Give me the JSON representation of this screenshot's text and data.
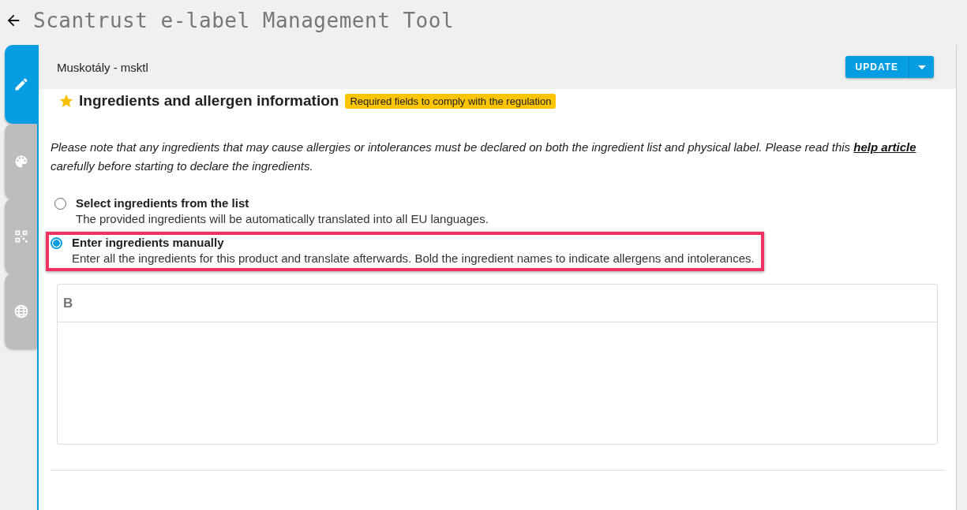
{
  "app_bar": {
    "title": "Scantrust e-label Management Tool"
  },
  "side_tabs": [
    {
      "kind": "pencil",
      "selected": true
    },
    {
      "kind": "palette",
      "selected": false
    },
    {
      "kind": "qr",
      "selected": false
    },
    {
      "kind": "globe",
      "selected": false
    }
  ],
  "panel": {
    "product": "Muskotály - msktl",
    "update_button": "UPDATE"
  },
  "section": {
    "title": "Ingredients and allergen information",
    "badge": "Required fields to comply with the regulation",
    "note_before": "Please note that any ingredients that may cause allergies or intolerances must be declared on both the ingredient list and physical label. Please read this",
    "note_link": "help article",
    "note_after": "carefully before starting to declare the ingredients."
  },
  "options": [
    {
      "label": "Select ingredients from the list",
      "description": "The provided ingredients will be automatically translated into all EU languages.",
      "selected": false,
      "highlighted": false
    },
    {
      "label": "Enter ingredients manually",
      "description": "Enter all the ingredients for this product and translate afterwards. Bold the ingredient names to indicate allergens and intolerances.",
      "selected": true,
      "highlighted": true
    }
  ],
  "editor": {
    "toolbar": [
      "B"
    ]
  }
}
